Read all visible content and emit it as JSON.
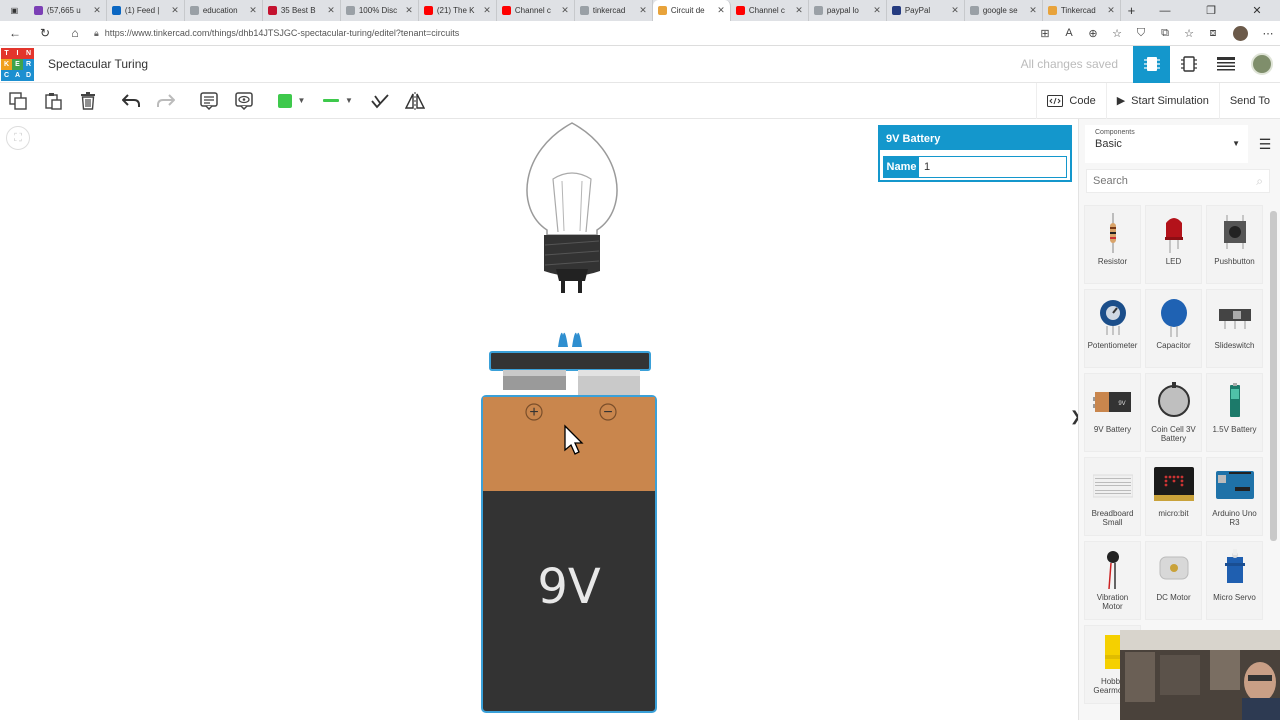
{
  "browser": {
    "tabs": [
      {
        "label": "(57,665 u",
        "color": "#7b3fb5"
      },
      {
        "label": "(1) Feed |",
        "color": "#0a66c2"
      },
      {
        "label": "education",
        "color": "#9aa0a6"
      },
      {
        "label": "35 Best B",
        "color": "#c4122f"
      },
      {
        "label": "100% Disc",
        "color": "#9aa0a6"
      },
      {
        "label": "(21) The K",
        "color": "#ff0000"
      },
      {
        "label": "Channel c",
        "color": "#ff0000"
      },
      {
        "label": "tinkercad",
        "color": "#9aa0a6"
      },
      {
        "label": "Circuit de",
        "color": "#e8a33b"
      },
      {
        "label": "Channel c",
        "color": "#ff0000"
      },
      {
        "label": "paypal lo",
        "color": "#9aa0a6"
      },
      {
        "label": "PayPal",
        "color": "#253b80"
      },
      {
        "label": "google se",
        "color": "#9aa0a6"
      },
      {
        "label": "Tinkercad",
        "color": "#e8a33b"
      }
    ],
    "active_tab_index": 8,
    "url": "https://www.tinkercad.com/things/dhb14JTSJGC-spectacular-turing/editel?tenant=circuits"
  },
  "header": {
    "logo_letters": [
      "T",
      "I",
      "N",
      "K",
      "E",
      "R",
      "C",
      "A",
      "D"
    ],
    "logo_colors": [
      "#e3352c",
      "#e3352c",
      "#e3352c",
      "#f0a01c",
      "#3fa34d",
      "#1c8fd0",
      "#1c8fd0",
      "#1c8fd0",
      "#1c8fd0"
    ],
    "project_title": "Spectacular Turing",
    "save_status": "All changes saved"
  },
  "toolbar": {
    "code_label": "Code",
    "start_simulation_label": "Start Simulation",
    "send_to_label": "Send To",
    "wire_color": "#3ec94c"
  },
  "canvas": {
    "battery_label": "9V",
    "battery_plus": "+",
    "battery_minus": "−"
  },
  "inspector": {
    "title": "9V Battery",
    "name_label": "Name",
    "name_value": "1"
  },
  "components": {
    "selector_label": "Components",
    "selected": "Basic",
    "search_placeholder": "Search",
    "items": [
      {
        "name": "Resistor",
        "icon": "resistor-icon"
      },
      {
        "name": "LED",
        "icon": "led-icon"
      },
      {
        "name": "Pushbutton",
        "icon": "pushbutton-icon"
      },
      {
        "name": "Potentiometer",
        "icon": "potentiometer-icon"
      },
      {
        "name": "Capacitor",
        "icon": "capacitor-icon"
      },
      {
        "name": "Slideswitch",
        "icon": "slideswitch-icon"
      },
      {
        "name": "9V Battery",
        "icon": "battery-9v-icon"
      },
      {
        "name": "Coin Cell 3V Battery",
        "icon": "coin-cell-icon"
      },
      {
        "name": "1.5V Battery",
        "icon": "battery-aa-icon"
      },
      {
        "name": "Breadboard Small",
        "icon": "breadboard-icon"
      },
      {
        "name": "micro:bit",
        "icon": "microbit-icon"
      },
      {
        "name": "Arduino Uno R3",
        "icon": "arduino-icon"
      },
      {
        "name": "Vibration Motor",
        "icon": "vibration-motor-icon"
      },
      {
        "name": "DC Motor",
        "icon": "dc-motor-icon"
      },
      {
        "name": "Micro Servo",
        "icon": "micro-servo-icon"
      },
      {
        "name": "Hobby Gearmotor",
        "icon": "gearmotor-icon"
      }
    ]
  }
}
